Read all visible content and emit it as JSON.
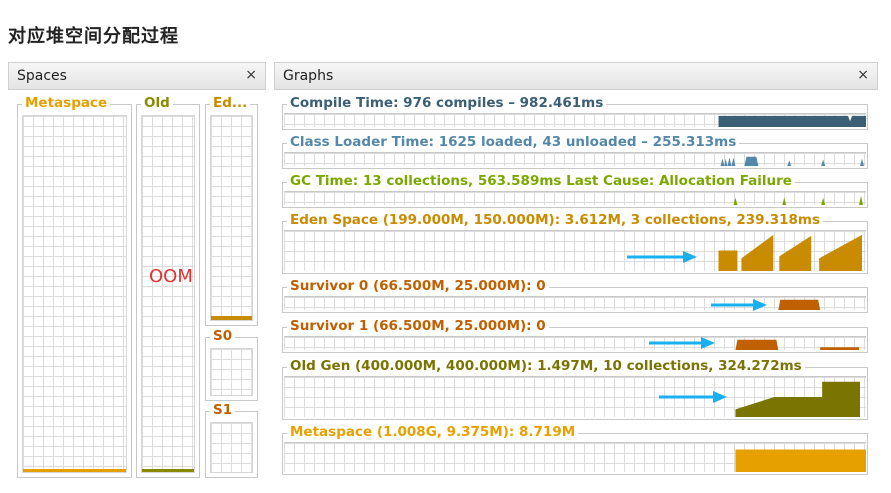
{
  "page": {
    "title": "对应堆空间分配过程"
  },
  "spaces_panel": {
    "title": "Spaces",
    "close": "×"
  },
  "graphs_panel": {
    "title": "Graphs",
    "close": "×"
  },
  "spaces": {
    "metaspace": {
      "label": "Metaspace",
      "color": "#e6a000"
    },
    "old": {
      "label": "Old",
      "color": "#8a8a00"
    },
    "eden": {
      "label": "Ed...",
      "color": "#c98b00"
    },
    "s0": {
      "label": "S0",
      "color": "#c06000"
    },
    "s1": {
      "label": "S1",
      "color": "#c06000"
    }
  },
  "annotation": {
    "oom": "OOM"
  },
  "graphs": {
    "compile": {
      "label": "Compile Time: 976 compiles – 982.461ms",
      "color": "#3b5f75"
    },
    "classloader": {
      "label": "Class Loader Time: 1625 loaded, 43 unloaded – 255.313ms",
      "color": "#5488aa"
    },
    "gc": {
      "label": "GC Time: 13 collections, 563.589ms Last Cause: Allocation Failure",
      "color": "#7aa800"
    },
    "eden": {
      "label": "Eden Space (199.000M, 150.000M): 3.612M, 3 collections, 239.318ms",
      "color": "#c98b00"
    },
    "survivor0": {
      "label": "Survivor 0 (66.500M, 25.000M): 0",
      "color": "#c06000"
    },
    "survivor1": {
      "label": "Survivor 1 (66.500M, 25.000M): 0",
      "color": "#c06000"
    },
    "oldgen": {
      "label": "Old Gen (400.000M, 400.000M): 1.497M, 10 collections, 324.272ms",
      "color": "#7a7400"
    },
    "metaspace": {
      "label": "Metaspace (1.008G, 9.375M): 8.719M",
      "color": "#e6a000"
    }
  },
  "arrow_color": "#1ab0f0"
}
